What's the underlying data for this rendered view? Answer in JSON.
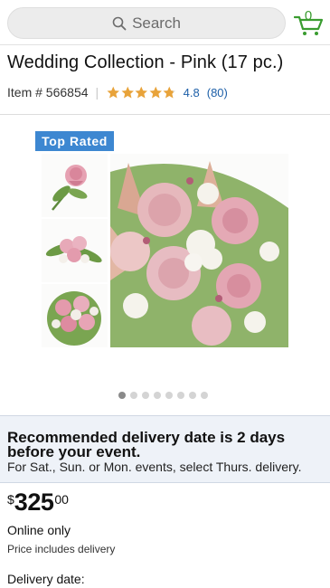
{
  "header": {
    "search_placeholder": "Search",
    "cart_count": "0",
    "icons": {
      "search": "search-icon",
      "cart": "cart-icon"
    },
    "accent_color": "#3a9c30"
  },
  "product": {
    "title": "Wedding Collection - Pink (17 pc.)",
    "item_number": "Item # 566854",
    "rating_value": "4.8",
    "rating_stars": 4.8,
    "rating_max": 5,
    "review_count": "(80)",
    "star_color": "#e8a33a",
    "link_color": "#1d5fa8"
  },
  "gallery": {
    "badge": "Top Rated",
    "badge_color": "#3d87d1",
    "image_count": 8,
    "active_index": 0
  },
  "promo": {
    "heading": "Recommended delivery date is 2 days before your event.",
    "subtext": "For Sat., Sun. or Mon. events, select Thurs. delivery."
  },
  "pricing": {
    "currency": "$",
    "whole": "325",
    "cents": "00",
    "availability": "Online only",
    "note": "Price includes delivery"
  },
  "delivery": {
    "label": "Delivery date:"
  }
}
